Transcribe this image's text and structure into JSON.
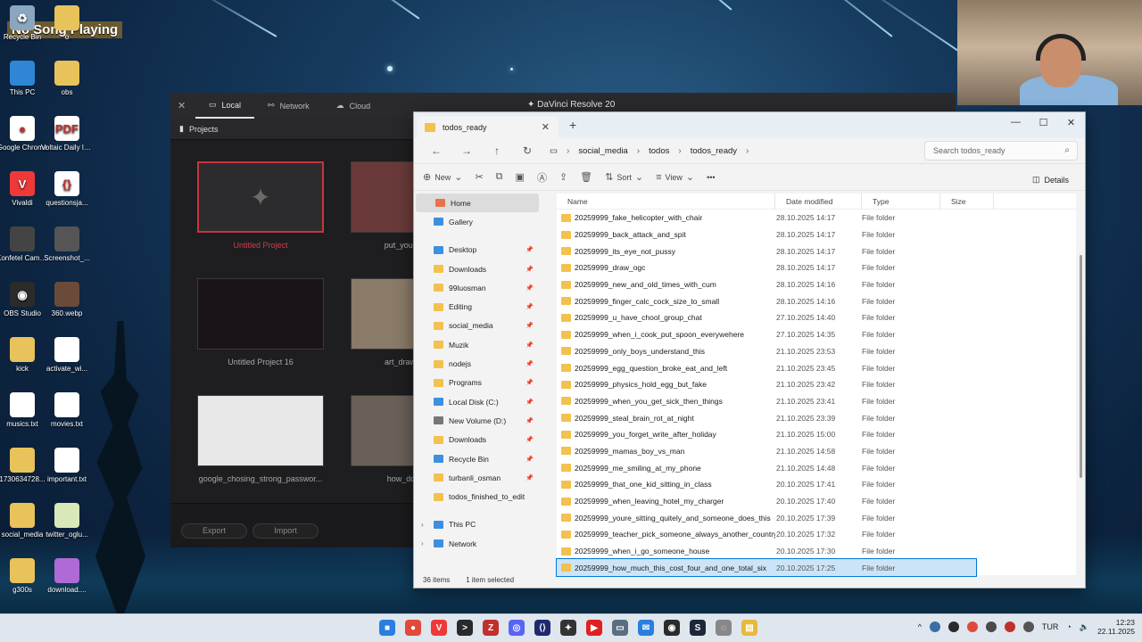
{
  "overlay": {
    "song": "No Song Playing"
  },
  "desktop_icons": [
    {
      "label": "Recycle Bin",
      "color": "#8aa6c0",
      "glyph": "♻"
    },
    {
      "label": "o",
      "color": "#e8c25a",
      "glyph": ""
    },
    {
      "label": "This PC",
      "color": "#2f86d6",
      "glyph": ""
    },
    {
      "label": "obs",
      "color": "#e8c25a",
      "glyph": ""
    },
    {
      "label": "Google Chrome",
      "color": "#ffffff",
      "glyph": "●"
    },
    {
      "label": "Voltaic Daily Improveme...",
      "color": "#ffffff",
      "glyph": "PDF"
    },
    {
      "label": "Vivaldi",
      "color": "#ef3939",
      "glyph": "V"
    },
    {
      "label": "questionsja...",
      "color": "#ffffff",
      "glyph": "{}"
    },
    {
      "label": "Konfetel Came...",
      "color": "#444444",
      "glyph": ""
    },
    {
      "label": "Screenshot_...",
      "color": "#555555",
      "glyph": ""
    },
    {
      "label": "OBS Studio",
      "color": "#2b2b2b",
      "glyph": "◉"
    },
    {
      "label": "360.webp",
      "color": "#6a4b3a",
      "glyph": ""
    },
    {
      "label": "kick",
      "color": "#e8c25a",
      "glyph": ""
    },
    {
      "label": "activate_wi...",
      "color": "#ffffff",
      "glyph": ""
    },
    {
      "label": "musics.txt",
      "color": "#ffffff",
      "glyph": ""
    },
    {
      "label": "movies.txt",
      "color": "#ffffff",
      "glyph": ""
    },
    {
      "label": "1730634728...",
      "color": "#e8c25a",
      "glyph": ""
    },
    {
      "label": "important.txt",
      "color": "#ffffff",
      "glyph": ""
    },
    {
      "label": "social_media",
      "color": "#e8c25a",
      "glyph": ""
    },
    {
      "label": "twitter_oglu...",
      "color": "#d8e8b8",
      "glyph": ""
    },
    {
      "label": "g300s",
      "color": "#e8c25a",
      "glyph": ""
    },
    {
      "label": "download....",
      "color": "#b06ad6",
      "glyph": ""
    }
  ],
  "davinci": {
    "title": "DaVinci Resolve 20",
    "tabs": [
      "Local",
      "Network",
      "Cloud"
    ],
    "section": "Projects",
    "projects": [
      {
        "name": "Untitled Project",
        "thumb": "#2c2c2e",
        "selected": true
      },
      {
        "name": "put_your_nose_i",
        "thumb": "#6a3a3a"
      },
      {
        "name": "Untitled Project 16",
        "thumb": "#1a1418"
      },
      {
        "name": "art_draw_circle_",
        "thumb": "#8a7a68"
      },
      {
        "name": "google_chosing_strong_passwor...",
        "thumb": "#e8e8e8"
      },
      {
        "name": "how_do_boys_",
        "thumb": "#6a6058"
      }
    ],
    "buttons": {
      "export": "Export",
      "import": "Import"
    }
  },
  "explorer": {
    "tab_title": "todos_ready",
    "breadcrumbs": [
      "social_media",
      "todos",
      "todos_ready"
    ],
    "search_placeholder": "Search todos_ready",
    "toolbar": {
      "new": "New",
      "sort": "Sort",
      "view": "View",
      "more": "•••",
      "details": "Details"
    },
    "nav": [
      {
        "label": "Home",
        "kind": "home"
      },
      {
        "label": "Gallery",
        "kind": "gallery"
      },
      {
        "label": "",
        "kind": "spacer"
      },
      {
        "label": "Desktop",
        "kind": "blue",
        "pin": true
      },
      {
        "label": "Downloads",
        "kind": "folder",
        "pin": true
      },
      {
        "label": "99luosman",
        "kind": "folder",
        "pin": true
      },
      {
        "label": "Editing",
        "kind": "folder",
        "pin": true
      },
      {
        "label": "social_media",
        "kind": "folder",
        "pin": true
      },
      {
        "label": "Muzik",
        "kind": "folder",
        "pin": true
      },
      {
        "label": "nodejs",
        "kind": "folder",
        "pin": true
      },
      {
        "label": "Programs",
        "kind": "folder",
        "pin": true
      },
      {
        "label": "Local Disk (C:)",
        "kind": "blue",
        "pin": true
      },
      {
        "label": "New Volume (D:)",
        "kind": "gray",
        "pin": true
      },
      {
        "label": "Downloads",
        "kind": "folder",
        "pin": true
      },
      {
        "label": "Recycle Bin",
        "kind": "blue",
        "pin": true
      },
      {
        "label": "turbanli_osman",
        "kind": "folder",
        "pin": true
      },
      {
        "label": "todos_finished_to_edit",
        "kind": "folder"
      },
      {
        "label": "",
        "kind": "spacer"
      },
      {
        "label": "This PC",
        "kind": "blue",
        "chev": true
      },
      {
        "label": "Network",
        "kind": "blue",
        "chev": true
      }
    ],
    "columns": [
      "Name",
      "Date modified",
      "Type",
      "Size"
    ],
    "files": [
      [
        "20259999_fake_helicopter_with_chair",
        "28.10.2025 14:17",
        "File folder"
      ],
      [
        "20259999_back_attack_and_spit",
        "28.10.2025 14:17",
        "File folder"
      ],
      [
        "20259999_its_eye_not_pussy",
        "28.10.2025 14:17",
        "File folder"
      ],
      [
        "20259999_draw_ogc",
        "28.10.2025 14:17",
        "File folder"
      ],
      [
        "20259999_new_and_old_times_with_cum",
        "28.10.2025 14:16",
        "File folder"
      ],
      [
        "20259999_finger_calc_cock_size_to_small",
        "28.10.2025 14:16",
        "File folder"
      ],
      [
        "20259999_u_have_chool_group_chat",
        "27.10.2025 14:40",
        "File folder"
      ],
      [
        "20259999_when_i_cook_put_spoon_everywehere",
        "27.10.2025 14:35",
        "File folder"
      ],
      [
        "20259999_only_boys_understand_this",
        "21.10.2025 23:53",
        "File folder"
      ],
      [
        "20259999_egg_question_broke_eat_and_left",
        "21.10.2025 23:45",
        "File folder"
      ],
      [
        "20259999_physics_hold_egg_but_fake",
        "21.10.2025 23:42",
        "File folder"
      ],
      [
        "20259999_when_you_get_sick_then_things",
        "21.10.2025 23:41",
        "File folder"
      ],
      [
        "20259999_steal_brain_rot_at_night",
        "21.10.2025 23:39",
        "File folder"
      ],
      [
        "20259999_you_forget_write_after_holiday",
        "21.10.2025 15:00",
        "File folder"
      ],
      [
        "20259999_mamas_boy_vs_man",
        "21.10.2025 14:58",
        "File folder"
      ],
      [
        "20259999_me_smiling_at_my_phone",
        "21.10.2025 14:48",
        "File folder"
      ],
      [
        "20259999_that_one_kid_sitting_in_class",
        "20.10.2025 17:41",
        "File folder"
      ],
      [
        "20259999_when_leaving_hotel_my_charger",
        "20.10.2025 17:40",
        "File folder"
      ],
      [
        "20259999_youre_sitting_quitely_and_someone_does_this",
        "20.10.2025 17:39",
        "File folder"
      ],
      [
        "20259999_teacher_pick_someone_always_another_country",
        "20.10.2025 17:32",
        "File folder"
      ],
      [
        "20259999_when_i_go_someone_house",
        "20.10.2025 17:30",
        "File folder"
      ],
      [
        "20259999_how_much_this_cost_four_and_one_total_six",
        "20.10.2025 17:25",
        "File folder"
      ]
    ],
    "selected_index": 21,
    "status": {
      "count": "36 items",
      "selected": "1 item selected"
    }
  },
  "taskbar": {
    "apps": [
      {
        "name": "windows-start",
        "color": "#2a7ee0",
        "glyph": "■"
      },
      {
        "name": "chrome",
        "color": "#e04a3a",
        "glyph": "●"
      },
      {
        "name": "vivaldi",
        "color": "#ef3939",
        "glyph": "V"
      },
      {
        "name": "terminal",
        "color": "#2a2a2a",
        "glyph": ">"
      },
      {
        "name": "filezilla",
        "color": "#c0312d",
        "glyph": "Z"
      },
      {
        "name": "discord",
        "color": "#5865f2",
        "glyph": "◎"
      },
      {
        "name": "vscode",
        "color": "#1f2a6e",
        "glyph": "⟨⟩"
      },
      {
        "name": "davinci",
        "color": "#333333",
        "glyph": "✦"
      },
      {
        "name": "youtube",
        "color": "#e02020",
        "glyph": "▶"
      },
      {
        "name": "explorer-2",
        "color": "#5a6e80",
        "glyph": "▭"
      },
      {
        "name": "email",
        "color": "#2a7ee0",
        "glyph": "✉"
      },
      {
        "name": "obs",
        "color": "#2b2b2b",
        "glyph": "◉"
      },
      {
        "name": "steam",
        "color": "#1b2838",
        "glyph": "S"
      },
      {
        "name": "onepass",
        "color": "#888888",
        "glyph": "◌"
      },
      {
        "name": "file-explorer",
        "color": "#e8b93a",
        "glyph": "▤"
      }
    ],
    "lang": "TUR",
    "time": "12:23",
    "date": "22.11.2025"
  }
}
